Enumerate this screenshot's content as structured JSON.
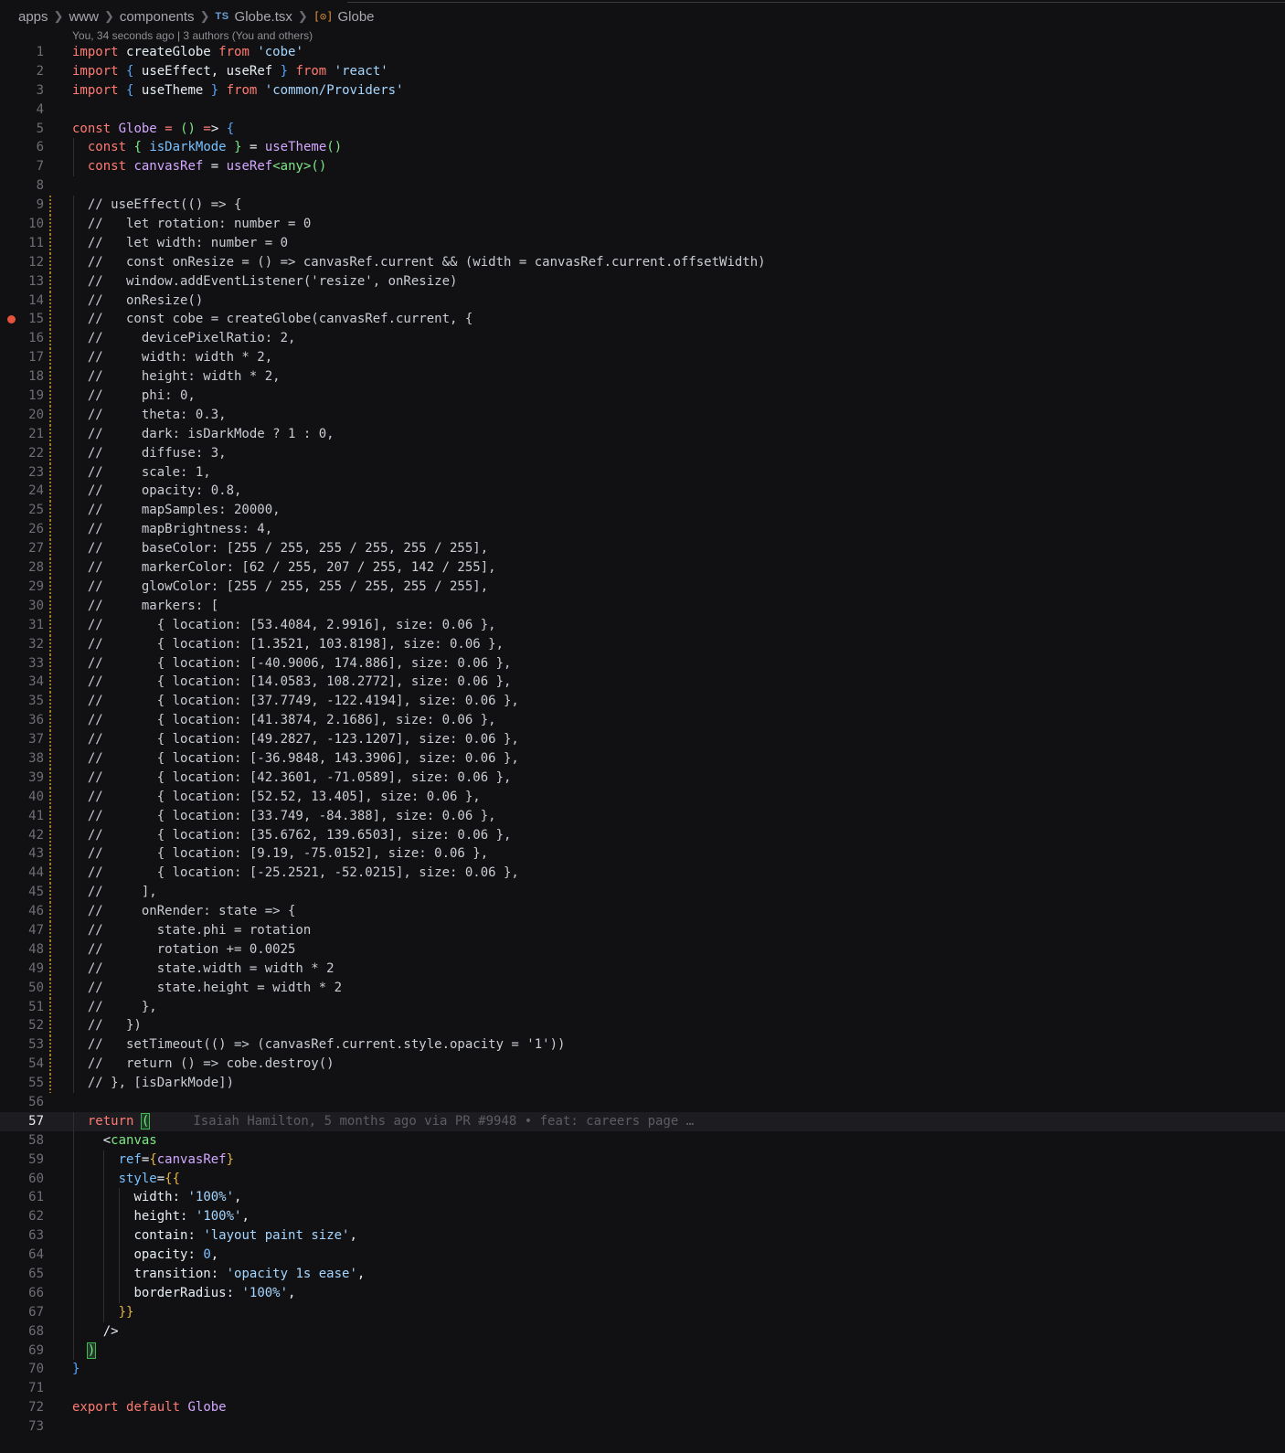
{
  "breadcrumb": {
    "items": [
      "apps",
      "www",
      "components"
    ],
    "file_badge": "TS",
    "file": "Globe.tsx",
    "symbol_icon": "symbol-icon",
    "symbol": "Globe"
  },
  "blame_header": "You, 34 seconds ago | 3 authors (You and others)",
  "current_line": 57,
  "breakpoint_line": 15,
  "inline_blame": "Isaiah Hamilton, 5 months ago via PR #9948 • feat: careers page …",
  "lines": [
    "import createGlobe from 'cobe'",
    "import { useEffect, useRef } from 'react'",
    "import { useTheme } from 'common/Providers'",
    "",
    "const Globe = () => {",
    "  const { isDarkMode } = useTheme()",
    "  const canvasRef = useRef<any>()",
    "",
    "  // useEffect(() => {",
    "  //   let rotation: number = 0",
    "  //   let width: number = 0",
    "  //   const onResize = () => canvasRef.current && (width = canvasRef.current.offsetWidth)",
    "  //   window.addEventListener('resize', onResize)",
    "  //   onResize()",
    "  //   const cobe = createGlobe(canvasRef.current, {",
    "  //     devicePixelRatio: 2,",
    "  //     width: width * 2,",
    "  //     height: width * 2,",
    "  //     phi: 0,",
    "  //     theta: 0.3,",
    "  //     dark: isDarkMode ? 1 : 0,",
    "  //     diffuse: 3,",
    "  //     scale: 1,",
    "  //     opacity: 0.8,",
    "  //     mapSamples: 20000,",
    "  //     mapBrightness: 4,",
    "  //     baseColor: [255 / 255, 255 / 255, 255 / 255],",
    "  //     markerColor: [62 / 255, 207 / 255, 142 / 255],",
    "  //     glowColor: [255 / 255, 255 / 255, 255 / 255],",
    "  //     markers: [",
    "  //       { location: [53.4084, 2.9916], size: 0.06 },",
    "  //       { location: [1.3521, 103.8198], size: 0.06 },",
    "  //       { location: [-40.9006, 174.886], size: 0.06 },",
    "  //       { location: [14.0583, 108.2772], size: 0.06 },",
    "  //       { location: [37.7749, -122.4194], size: 0.06 },",
    "  //       { location: [41.3874, 2.1686], size: 0.06 },",
    "  //       { location: [49.2827, -123.1207], size: 0.06 },",
    "  //       { location: [-36.9848, 143.3906], size: 0.06 },",
    "  //       { location: [42.3601, -71.0589], size: 0.06 },",
    "  //       { location: [52.52, 13.405], size: 0.06 },",
    "  //       { location: [33.749, -84.388], size: 0.06 },",
    "  //       { location: [35.6762, 139.6503], size: 0.06 },",
    "  //       { location: [9.19, -75.0152], size: 0.06 },",
    "  //       { location: [-25.2521, -52.0215], size: 0.06 },",
    "  //     ],",
    "  //     onRender: state => {",
    "  //       state.phi = rotation",
    "  //       rotation += 0.0025",
    "  //       state.width = width * 2",
    "  //       state.height = width * 2",
    "  //     },",
    "  //   })",
    "  //   setTimeout(() => (canvasRef.current.style.opacity = '1'))",
    "  //   return () => cobe.destroy()",
    "  // }, [isDarkMode])",
    "",
    "  return (",
    "    <canvas",
    "      ref={canvasRef}",
    "      style={{",
    "        width: '100%',",
    "        height: '100%',",
    "        contain: 'layout paint size',",
    "        opacity: 0,",
    "        transition: 'opacity 1s ease',",
    "        borderRadius: '100%',",
    "      }}",
    "    />",
    "  )",
    "}",
    "",
    "export default Globe",
    ""
  ]
}
